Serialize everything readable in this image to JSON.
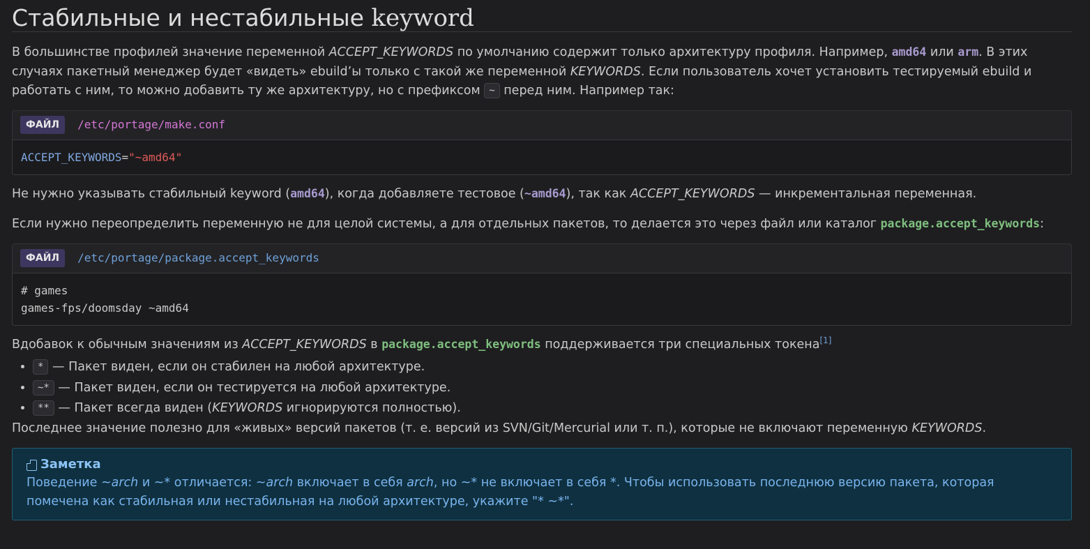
{
  "heading": {
    "text": "Стабильные и нестабильные ",
    "keyword": "keyword"
  },
  "para1": {
    "t1": "В большинстве профилей значение переменной ",
    "v1": "ACCEPT_KEYWORDS",
    "t2": " по умолчанию содержит только архитектуру профиля. Например, ",
    "c1": "amd64",
    "t3": " или ",
    "c2": "arm",
    "t4": ". В этих случаях пакетный менеджер будет «видеть» ebuild’ы только с такой же переменной ",
    "v2": "KEYWORDS",
    "t5": ". Если пользователь хочет установить тестируемый ebuild и работать с ним, то можно добавить ту же архитектуру, но с префиксом ",
    "chip": "~",
    "t6": " перед ним. Например так:"
  },
  "file1": {
    "label": "ФАЙЛ",
    "path": "/etc/portage/make.conf",
    "var": "ACCEPT_KEYWORDS",
    "eq": "=",
    "str": "\"~amd64\""
  },
  "para2": {
    "t1": "Не нужно указывать стабильный keyword (",
    "c1": "amd64",
    "t2": "), когда добавляете тестовое (",
    "c2": "~amd64",
    "t3": "), так как ",
    "v1": "ACCEPT_KEYWORDS",
    "t4": " — инкрементальная переменная."
  },
  "para3": {
    "t1": "Если нужно переопределить переменную не для целой системы, а для отдельных пакетов, то делается это через файл или каталог ",
    "pkg": "package.accept_keywords",
    "t2": ":"
  },
  "file2": {
    "label": "ФАЙЛ",
    "path": "/etc/portage/package.accept_keywords",
    "line1": "# games",
    "line2": "games-fps/doomsday ~amd64"
  },
  "para4": {
    "t1": "Вдобавок к обычным значениям из ",
    "v1": "ACCEPT_KEYWORDS",
    "t2": " в ",
    "pkg": "package.accept_keywords",
    "t3": " поддерживается три специальных токена",
    "sup": "[1]"
  },
  "tokens": [
    {
      "chip": "*",
      "text": " — Пакет виден, если он стабилен на любой архитектуре."
    },
    {
      "chip": "~*",
      "text": " — Пакет виден, если он тестируется на любой архитектуре."
    },
    {
      "chip": "**",
      "t1": " — Пакет всегда виден (",
      "v": "KEYWORDS",
      "t2": " игнорируются полностью)."
    }
  ],
  "para5": {
    "t1": "Последнее значение полезно для «живых» версий пакетов (т. е. версий из SVN/Git/Mercurial или т. п.), которые не включают переменную ",
    "v1": "KEYWORDS",
    "t2": "."
  },
  "note": {
    "title": "Заметка",
    "t1": "Поведение ",
    "i1": "~arch",
    "t2": " и ~* отличается: ",
    "i2": "~arch",
    "t3": " включает в себя ",
    "i3": "arch",
    "t4": ", но ~* не включает в себя *. Чтобы использовать последнюю версию пакета, которая помечена как стабильная или нестабильная на любой архитектуре, укажите \"* ~*\"."
  }
}
